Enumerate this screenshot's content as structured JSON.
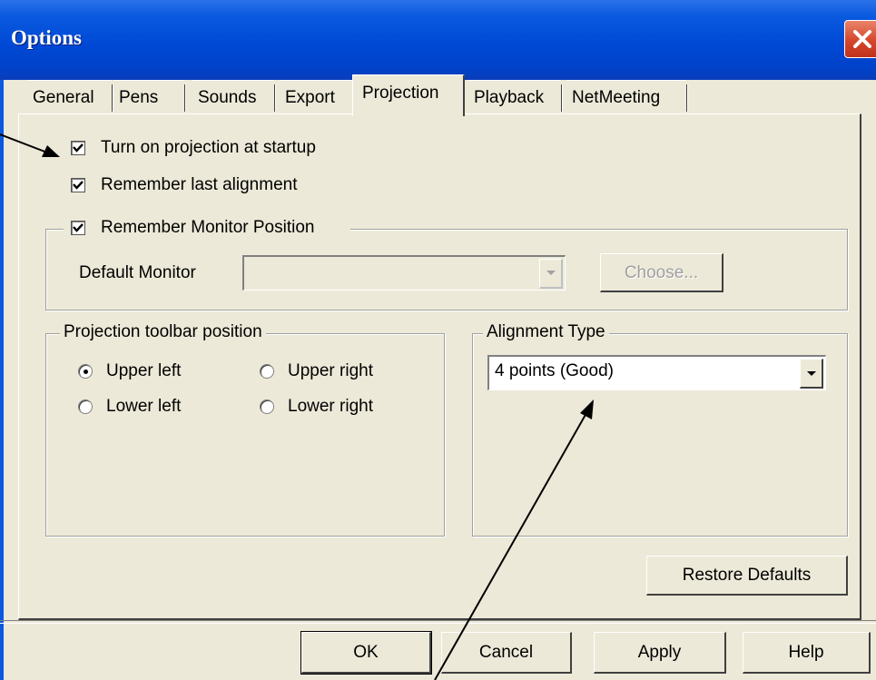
{
  "window": {
    "title": "Options"
  },
  "tabs": [
    {
      "label": "General"
    },
    {
      "label": "Pens"
    },
    {
      "label": "Sounds"
    },
    {
      "label": "Export"
    },
    {
      "label": "Projection",
      "active": true
    },
    {
      "label": "Playback"
    },
    {
      "label": "NetMeeting"
    }
  ],
  "projection": {
    "startup_label": "Turn on projection at startup",
    "startup_checked": true,
    "alignment_memory_label": "Remember last alignment",
    "alignment_memory_checked": true,
    "monitor_group": {
      "label": "Remember Monitor Position",
      "checked": true,
      "default_monitor_label": "Default Monitor",
      "default_monitor_value": "",
      "choose_label": "Choose..."
    },
    "toolbar_group": {
      "label": "Projection toolbar position",
      "options": [
        {
          "label": "Upper left",
          "selected": true
        },
        {
          "label": "Upper right",
          "selected": false
        },
        {
          "label": "Lower left",
          "selected": false
        },
        {
          "label": "Lower right",
          "selected": false
        }
      ]
    },
    "alignment_group": {
      "label": "Alignment Type",
      "value": "4 points (Good)"
    },
    "restore_label": "Restore Defaults"
  },
  "footer": {
    "ok_label": "OK",
    "cancel_label": "Cancel",
    "apply_label": "Apply",
    "help_label": "Help"
  },
  "colors": {
    "titlebar": "#0a5ae0",
    "face": "#ece9d8",
    "close": "#d5462a"
  },
  "icons": [
    "close-icon",
    "check-icon",
    "dropdown-arrow-icon",
    "arrow-annotation"
  ]
}
